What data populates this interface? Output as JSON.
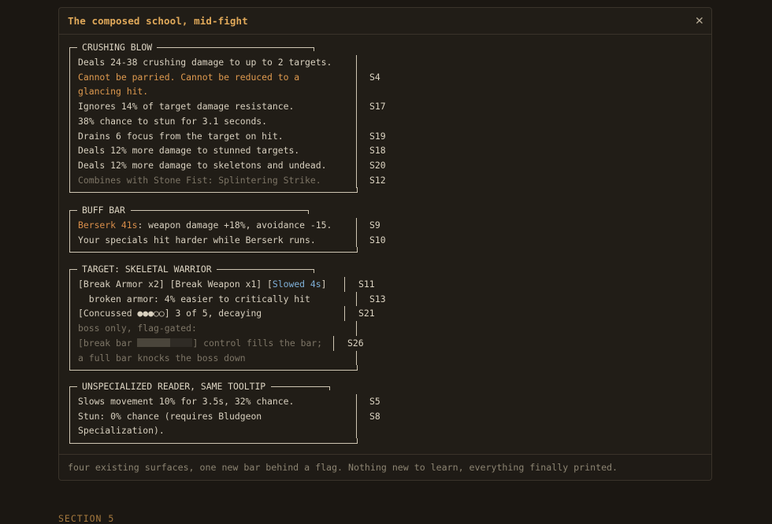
{
  "window": {
    "title": "The composed school, mid-fight",
    "close_glyph": "✕",
    "footer": "four existing surfaces, one new bar behind a flag. Nothing new to learn, everything finally printed."
  },
  "section_label": "SECTION 5",
  "blocks": {
    "crushing": {
      "header": "CRUSHING BLOW",
      "lines": [
        {
          "text": "Deals 24-38 crushing damage to up to 2 targets.",
          "tag": ""
        },
        {
          "text": "Cannot be parried. Cannot be reduced to a",
          "tag": "S4"
        },
        {
          "text": "glancing hit.",
          "tag": ""
        },
        {
          "text": "Ignores 14% of target damage resistance.",
          "tag": "S17"
        },
        {
          "text": "38% chance to stun for 3.1 seconds.",
          "tag": ""
        },
        {
          "text": "Drains 6 focus from the target on hit.",
          "tag": "S19"
        },
        {
          "text": "Deals 12% more damage to stunned targets.",
          "tag": "S18"
        },
        {
          "text": "Deals 12% more damage to skeletons and undead.",
          "tag": "S20"
        },
        {
          "text": "Combines with Stone Fist: Splintering Strike.",
          "tag": "S12"
        }
      ]
    },
    "buff": {
      "header": "BUFF BAR",
      "line1_highlight": "Berserk 41s",
      "line1_rest": ": weapon damage +18%, avoidance -15.",
      "line1_tag": "S9",
      "line2": "Your specials hit harder while Berserk runs.",
      "line2_tag": "S10"
    },
    "target": {
      "header": "TARGET: SKELETAL WARRIOR",
      "line1_a": "[Break Armor x2] [Break Weapon x1] [",
      "line1_slowed": "Slowed 4s",
      "line1_b": "]",
      "line1_tag": "S11",
      "line2": "  broken armor: 4% easier to critically hit",
      "line2_tag": "S13",
      "line3": "[Concussed ●●●○○] 3 of 5, decaying",
      "line3_tag": "S21",
      "line4": "boss only, flag-gated:",
      "line5_a": "[break bar ",
      "break_bar_fill": 0.6,
      "line5_b": "] control fills the bar;",
      "line5_tag": "S26",
      "line6": "a full bar knocks the boss down"
    },
    "unspec": {
      "header": "UNSPECIALIZED READER, SAME TOOLTIP",
      "line1": "Slows movement 10% for 3.5s, 32% chance.",
      "line1_tag": "S5",
      "line2": "Stun: 0% chance (requires Bludgeon",
      "line2_tag": "S8",
      "line3": "Specialization)."
    }
  }
}
